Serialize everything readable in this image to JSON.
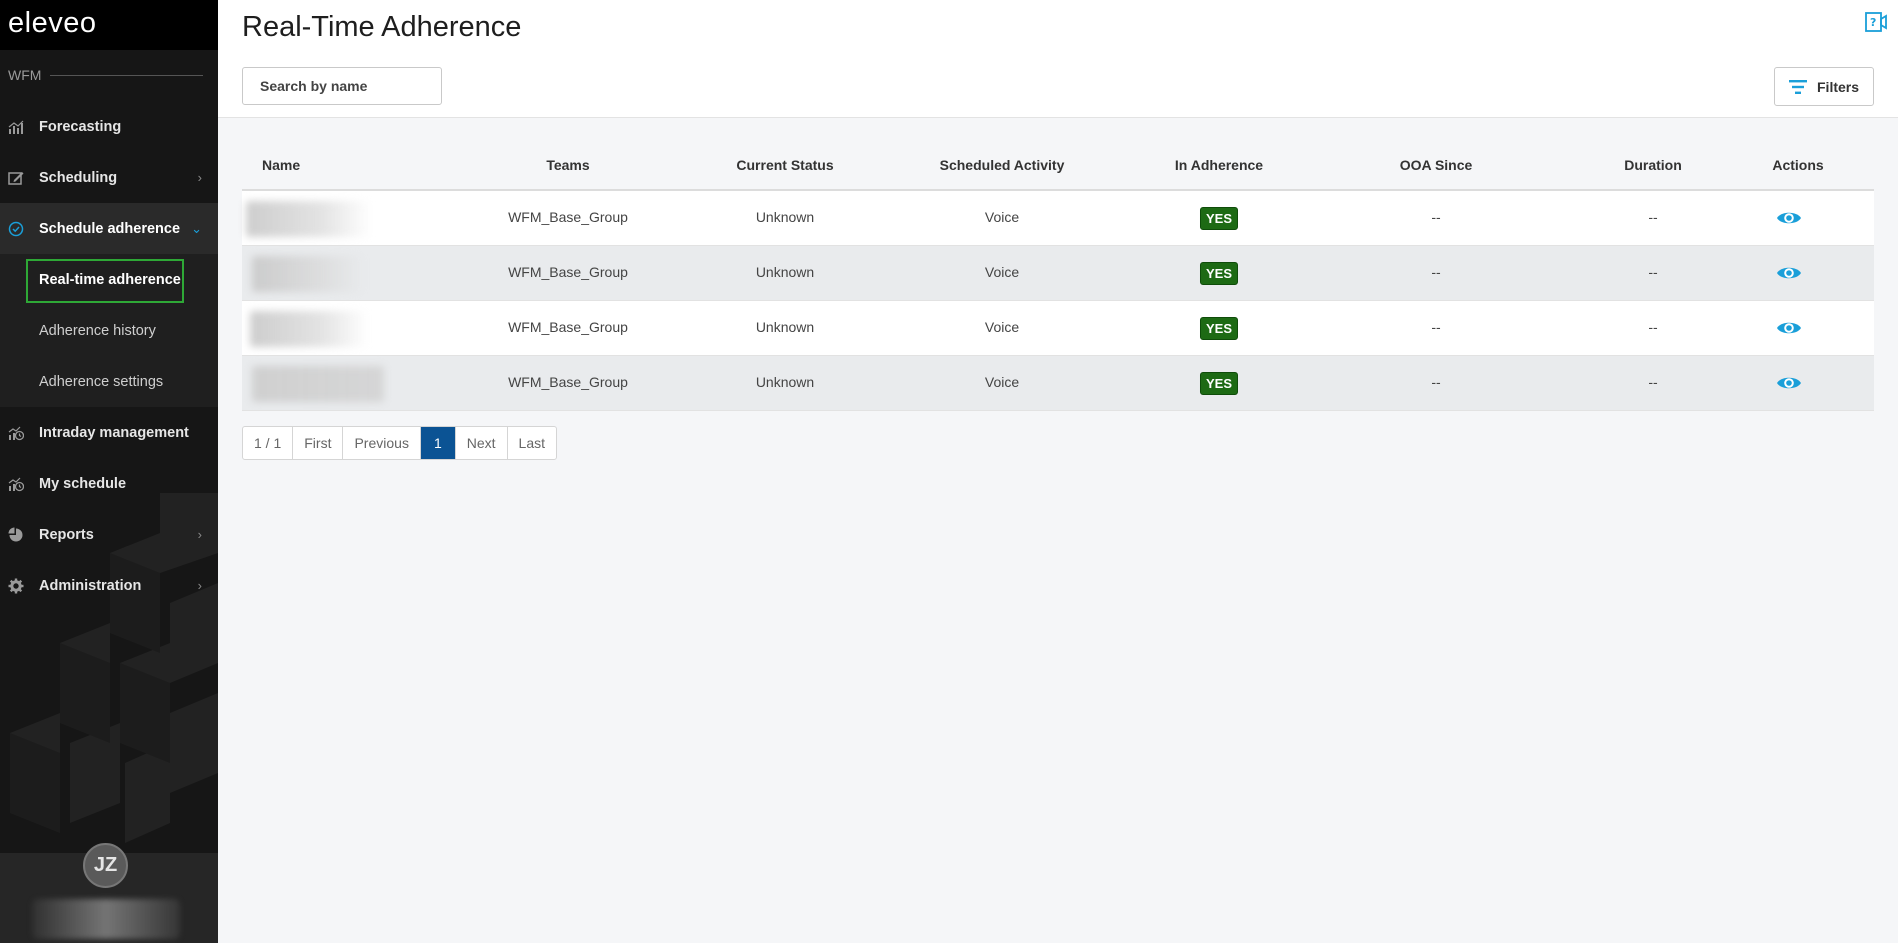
{
  "app": {
    "logo_text": "eleveo",
    "section_label": "WFM"
  },
  "sidebar": {
    "items": [
      {
        "label": "Forecasting",
        "icon": "forecasting-icon"
      },
      {
        "label": "Scheduling",
        "icon": "scheduling-icon",
        "has_children": true
      },
      {
        "label": "Schedule adherence",
        "icon": "adherence-icon",
        "expanded": true
      },
      {
        "label": "Intraday management",
        "icon": "intraday-icon"
      },
      {
        "label": "My schedule",
        "icon": "my-schedule-icon"
      },
      {
        "label": "Reports",
        "icon": "reports-icon",
        "has_children": true
      },
      {
        "label": "Administration",
        "icon": "gear-icon",
        "has_children": true
      }
    ],
    "sub_items": [
      {
        "label": "Real-time adherence",
        "current": true
      },
      {
        "label": "Adherence history"
      },
      {
        "label": "Adherence settings"
      }
    ],
    "user_initials": "JZ"
  },
  "header": {
    "title": "Real-Time Adherence",
    "search_placeholder": "Search by name",
    "filters_label": "Filters"
  },
  "table": {
    "columns": [
      "Name",
      "Teams",
      "Current Status",
      "Scheduled Activity",
      "In Adherence",
      "OOA Since",
      "Duration",
      "Actions"
    ],
    "rows": [
      {
        "name": "",
        "team": "WFM_Base_Group",
        "status": "Unknown",
        "activity": "Voice",
        "adherence": "YES",
        "ooa_since": "--",
        "duration": "--"
      },
      {
        "name": "",
        "team": "WFM_Base_Group",
        "status": "Unknown",
        "activity": "Voice",
        "adherence": "YES",
        "ooa_since": "--",
        "duration": "--"
      },
      {
        "name": "",
        "team": "WFM_Base_Group",
        "status": "Unknown",
        "activity": "Voice",
        "adherence": "YES",
        "ooa_since": "--",
        "duration": "--"
      },
      {
        "name": "",
        "team": "WFM_Base_Group",
        "status": "Unknown",
        "activity": "Voice",
        "adherence": "YES",
        "ooa_since": "--",
        "duration": "--"
      }
    ]
  },
  "pagination": {
    "info": "1 / 1",
    "first": "First",
    "previous": "Previous",
    "current": "1",
    "next": "Next",
    "last": "Last"
  },
  "colors": {
    "sidebar_bg": "#161616",
    "accent_blue": "#1a9fd9",
    "yes_badge": "#1d6a14",
    "current_page": "#0b5394",
    "highlight_outline": "#2ea836"
  }
}
